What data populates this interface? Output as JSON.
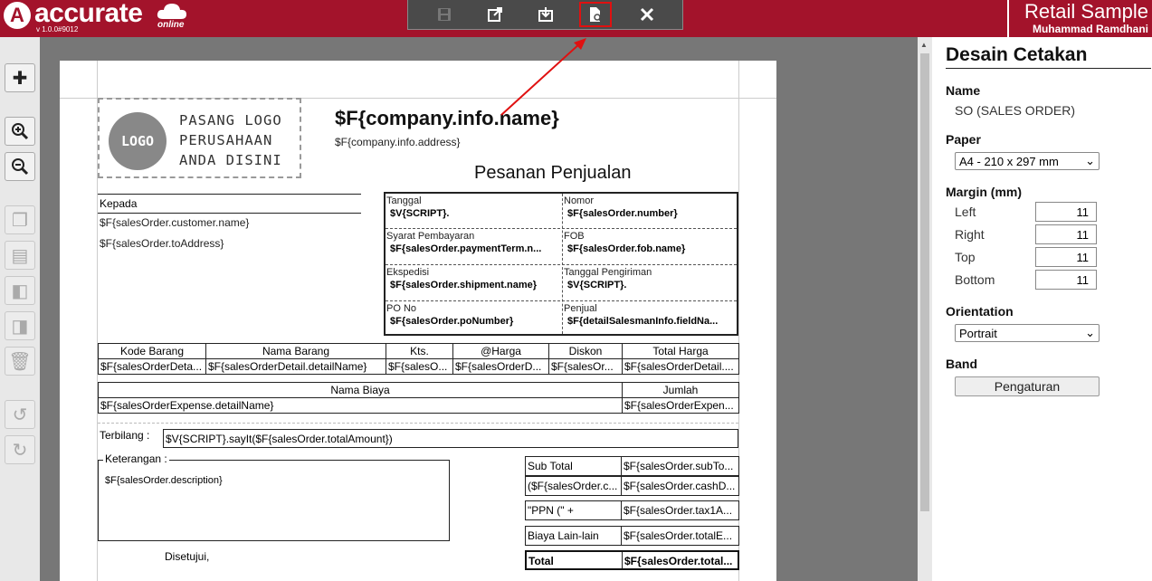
{
  "app": {
    "brand": "accurate",
    "version": "v 1.0.0#9012",
    "online": "online",
    "company_name": "Retail Sample",
    "user_name": "Muhammad Ramdhani"
  },
  "toolbar": {
    "save": "save-icon",
    "export": "export-icon",
    "import": "import-icon",
    "preview": "preview-document-icon",
    "close": "close-icon"
  },
  "accent": "#a3132b",
  "document": {
    "logo_circle": "LOGO",
    "logo_text_1": "PASANG LOGO",
    "logo_text_2": "PERUSAHAAN",
    "logo_text_3": "ANDA DISINI",
    "company_name": "$F{company.info.name}",
    "company_address": "$F{company.info.address}",
    "title": "Pesanan Penjualan",
    "kepada_label": "Kepada",
    "customer_name": "$F{salesOrder.customer.name}",
    "to_address": "$F{salesOrder.toAddress}",
    "info": {
      "tanggal_label": "Tanggal",
      "tanggal_value": "$V{SCRIPT}.",
      "nomor_label": "Nomor",
      "nomor_value": "$F{salesOrder.number}",
      "syarat_label": "Syarat Pembayaran",
      "syarat_value": "$F{salesOrder.paymentTerm.n...",
      "fob_label": "FOB",
      "fob_value": "$F{salesOrder.fob.name}",
      "ekspedisi_label": "Ekspedisi",
      "ekspedisi_value": "$F{salesOrder.shipment.name}",
      "tgl_kirim_label": "Tanggal Pengiriman",
      "tgl_kirim_value": "$V{SCRIPT}.",
      "po_label": "PO No",
      "po_value": "$F{salesOrder.poNumber}",
      "penjual_label": "Penjual",
      "penjual_value": "$F{detailSalesmanInfo.fieldNa..."
    },
    "detail_headers": [
      "Kode Barang",
      "Nama Barang",
      "Kts.",
      "@Harga",
      "Diskon",
      "Total Harga"
    ],
    "detail_row": [
      "$F{salesOrderDeta...",
      "$F{salesOrderDetail.detailName}",
      "$F{salesO...",
      "$F{salesOrderD...",
      "$F{salesOr...",
      "$F{salesOrderDetail...."
    ],
    "expense_headers": [
      "Nama Biaya",
      "Jumlah"
    ],
    "expense_row": [
      "$F{salesOrderExpense.detailName}",
      "$F{salesOrderExpen..."
    ],
    "terbilang_label": "Terbilang :",
    "terbilang_value": "$V{SCRIPT}.sayIt($F{salesOrder.totalAmount})",
    "keterangan_label": "Keterangan :",
    "keterangan_value": "$F{salesOrder.description}",
    "disetujui": "Disetujui,",
    "totals": [
      {
        "label": "Sub Total",
        "value": "$F{salesOrder.subTo..."
      },
      {
        "label": "($F{salesOrder.c...",
        "value": "$F{salesOrder.cashD..."
      },
      {
        "label": "\"PPN (\" +",
        "value": "$F{salesOrder.tax1A..."
      },
      {
        "label": "Biaya Lain-lain",
        "value": "$F{salesOrder.totalE..."
      },
      {
        "label": "Total",
        "value": "$F{salesOrder.total..."
      }
    ]
  },
  "panel": {
    "title": "Desain Cetakan",
    "name_label": "Name",
    "name_value": "SO (SALES ORDER)",
    "paper_label": "Paper",
    "paper_value": "A4 - 210 x 297 mm",
    "margin_label": "Margin (mm)",
    "left_label": "Left",
    "left_value": "11",
    "right_label": "Right",
    "right_value": "11",
    "top_label": "Top",
    "top_value": "11",
    "bottom_label": "Bottom",
    "bottom_value": "11",
    "orientation_label": "Orientation",
    "orientation_value": "Portrait",
    "band_label": "Band",
    "band_button": "Pengaturan"
  }
}
